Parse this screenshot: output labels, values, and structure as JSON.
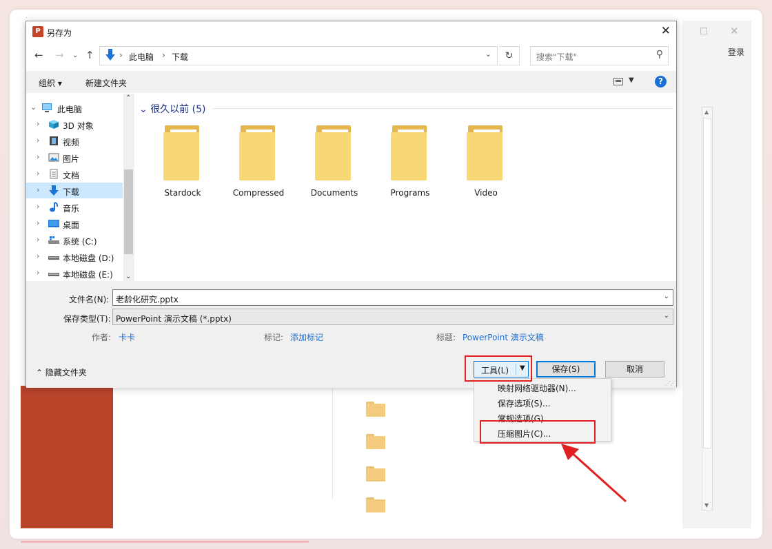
{
  "backdrop": {
    "login": "登录"
  },
  "dialog": {
    "title": "另存为",
    "app_icon_letter": "P",
    "breadcrumb": [
      "此电脑",
      "下载"
    ],
    "search_placeholder": "搜索\"下载\"",
    "toolbar": {
      "organize": "组织 ▾",
      "new_folder": "新建文件夹"
    },
    "tree": [
      {
        "label": "此电脑",
        "icon": "computer-icon"
      },
      {
        "label": "3D 对象",
        "icon": "cube-icon"
      },
      {
        "label": "视频",
        "icon": "film-icon"
      },
      {
        "label": "图片",
        "icon": "picture-icon"
      },
      {
        "label": "文档",
        "icon": "document-icon"
      },
      {
        "label": "下载",
        "icon": "download-icon",
        "selected": true
      },
      {
        "label": "音乐",
        "icon": "music-note-icon"
      },
      {
        "label": "桌面",
        "icon": "desktop-icon"
      },
      {
        "label": "系统 (C:)",
        "icon": "system-drive-icon"
      },
      {
        "label": "本地磁盘 (D:)",
        "icon": "drive-icon"
      },
      {
        "label": "本地磁盘 (E:)",
        "icon": "drive-icon"
      }
    ],
    "group_header": "很久以前 (5)",
    "folders": [
      "Stardock",
      "Compressed",
      "Documents",
      "Programs",
      "Video"
    ],
    "filename_label": "文件名(N):",
    "filename_value": "老龄化研究.pptx",
    "filetype_label": "保存类型(T):",
    "filetype_value": "PowerPoint 演示文稿 (*.pptx)",
    "author_label": "作者:",
    "author_value": "卡卡",
    "tags_label": "标记:",
    "tags_value": "添加标记",
    "title_label": "标题:",
    "title_value": "PowerPoint 演示文稿",
    "hide_folders": "隐藏文件夹",
    "tools_label": "工具(L)",
    "save_label": "保存(S)",
    "cancel_label": "取消"
  },
  "tools_menu": [
    "映射网络驱动器(N)...",
    "保存选项(S)...",
    "常规选项(G)...",
    "压缩图片(C)..."
  ],
  "colors": {
    "annotation_red": "#e02020",
    "powerpoint_red": "#b8442a",
    "link_blue": "#1a6fd4"
  }
}
